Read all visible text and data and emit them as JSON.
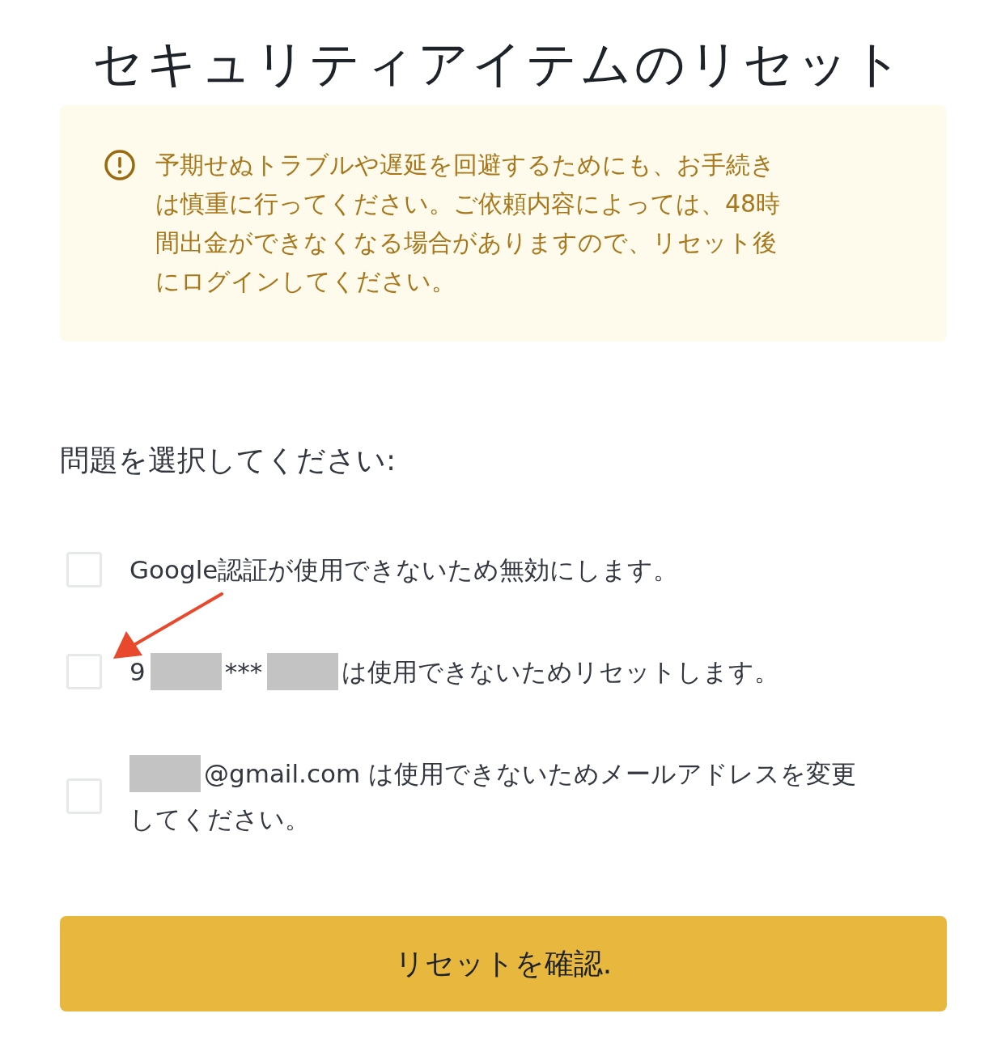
{
  "title": "セキュリティアイテムのリセット",
  "notice": {
    "lines": [
      "予期せぬトラブルや遅延を回避するためにも、お手続き",
      "は慎重に行ってください。ご依頼内容によっては、48時",
      "間出金ができなくなる場合がありますので、リセット後",
      "にログインしてください。"
    ]
  },
  "prompt": "問題を選択してください:",
  "options": [
    {
      "checked": false,
      "segments": [
        {
          "kind": "text",
          "text": "Google認証が使用できないため無効にします。"
        }
      ]
    },
    {
      "checked": false,
      "annotated": true,
      "segments": [
        {
          "kind": "text",
          "text": "9"
        },
        {
          "kind": "redacted"
        },
        {
          "kind": "text",
          "text": "***"
        },
        {
          "kind": "redacted"
        },
        {
          "kind": "text",
          "text": "は使用できないためリセットします。"
        }
      ]
    },
    {
      "checked": false,
      "segments": [
        {
          "kind": "redacted"
        },
        {
          "kind": "text",
          "text": "@gmail.com は使用できないためメールアドレスを変更"
        },
        {
          "kind": "text",
          "text": "してください。"
        }
      ]
    }
  ],
  "confirm_button": "リセットを確認."
}
